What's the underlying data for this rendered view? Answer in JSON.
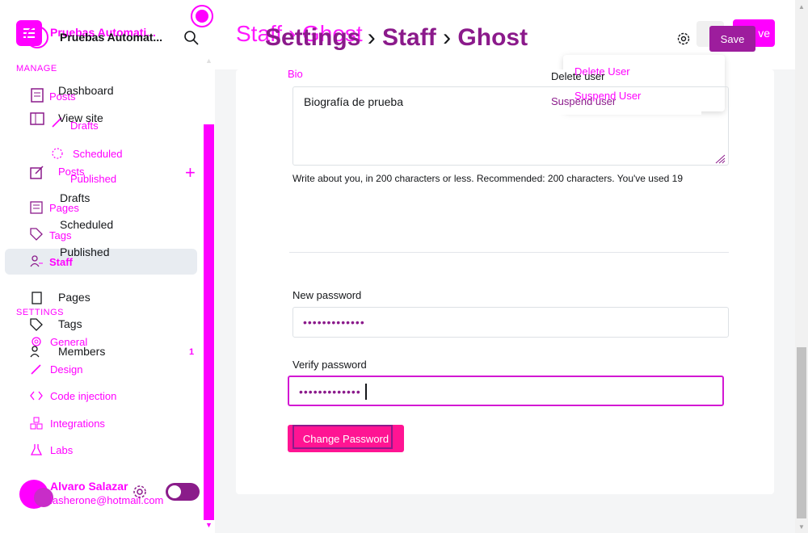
{
  "sidebar": {
    "brand": {
      "name": "Pruebas Automati...",
      "name_overlay": "Pruebas Automat..."
    },
    "sections": {
      "manage": "MANAGE",
      "settings": "SETTINGS"
    },
    "nav_pink": {
      "posts": "Posts",
      "drafts": "Drafts",
      "scheduled": "Scheduled",
      "posts2": "Posts",
      "published": "Published",
      "pages": "Pages",
      "tags": "Tags",
      "staff": "Staff",
      "general": "General",
      "design": "Design",
      "code_injection": "Code injection",
      "integrations": "Integrations",
      "labs": "Labs"
    },
    "nav_dark": {
      "dashboard": "Dashboard",
      "view_site": "View site",
      "drafts": "Drafts",
      "scheduled": "Scheduled",
      "published": "Published",
      "pages": "Pages",
      "tags": "Tags",
      "members": "Members",
      "members_count": "1"
    },
    "user": {
      "name": "Alvaro Salazar",
      "email": "lasherone@hotmail.com"
    }
  },
  "header": {
    "title_parts": [
      "Settings",
      "›",
      "Staff",
      "›",
      "Ghost"
    ],
    "ghost_title": "Staff  ›  Ghost",
    "save_label": "Save",
    "save_ghost_label": "ve"
  },
  "dropdown": {
    "delete_user": "Delete User",
    "suspend_user": "Suspend User",
    "delete_user_overlay": "Delete user",
    "suspend_user_overlay": "Suspend user"
  },
  "form": {
    "bio_label": "Bio",
    "bio_value": "Biografía de prueba",
    "bio_hint": "Write about you, in 200 characters or less. Recommended: 200 characters. You've used 19",
    "new_password_label": "New password",
    "new_password_value": "•••••••••••••",
    "verify_password_label": "Verify password",
    "verify_password_value": "•••••••••••••",
    "change_password_label": "Change Password"
  },
  "colors": {
    "accent": "#ff00ff",
    "accent_dark": "#8b1a8b",
    "button_pink": "#ff1493"
  }
}
